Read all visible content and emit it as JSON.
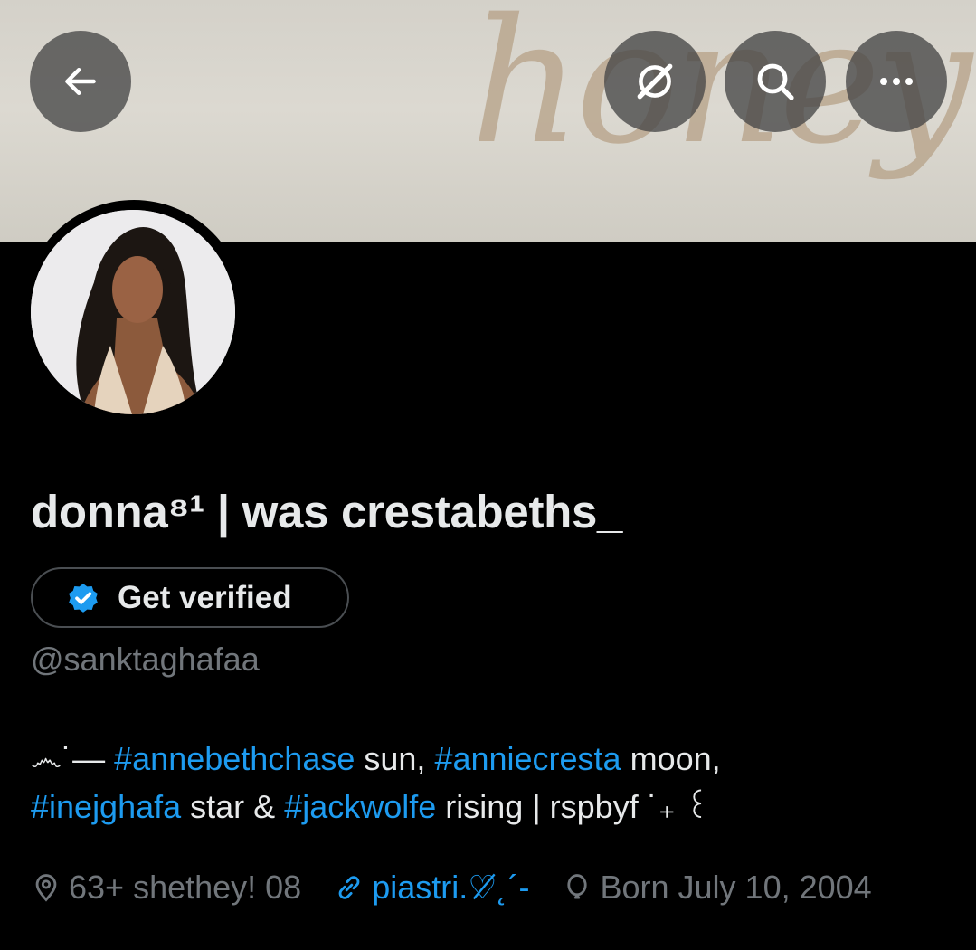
{
  "banner": {
    "script_text": "honey"
  },
  "header": {
    "back_icon": "arrow-left-icon",
    "grok_icon": "grok-icon",
    "search_icon": "search-icon",
    "more_icon": "more-horizontal-icon"
  },
  "profile": {
    "display_name": "donna⁸¹ | was crestabeths_",
    "verify_label": "Get verified",
    "handle": "@sanktaghafaa",
    "bio": {
      "prefix": "෴˙— ",
      "tag1": "#annebethchase",
      "text1": " sun, ",
      "tag2": "#anniecresta",
      "text2": " moon,",
      "tag3": "#inejghafa",
      "text3": " star & ",
      "tag4": "#jackwolfe",
      "text4": " rising | rspbyf ˙₊ ꒰"
    },
    "location": "63+ shethey! 08",
    "website": "piastri.♡̸˛´-",
    "birthday": "Born July 10, 2004"
  },
  "colors": {
    "accent": "#1d9bf0",
    "muted": "#71767b",
    "text": "#e7e9ea",
    "background": "#000000"
  }
}
